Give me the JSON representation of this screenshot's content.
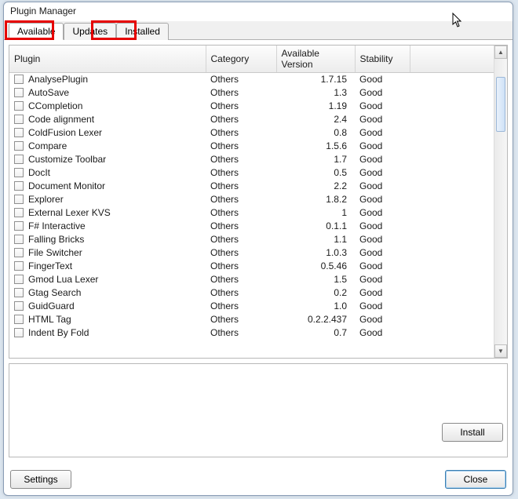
{
  "window": {
    "title": "Plugin Manager"
  },
  "tabs": {
    "available": "Available",
    "updates": "Updates",
    "installed": "Installed"
  },
  "columns": {
    "plugin": "Plugin",
    "category": "Category",
    "version": "Available Version",
    "stability": "Stability"
  },
  "rows": [
    {
      "name": "AnalysePlugin",
      "cat": "Others",
      "ver": "1.7.15",
      "stab": "Good"
    },
    {
      "name": "AutoSave",
      "cat": "Others",
      "ver": "1.3",
      "stab": "Good"
    },
    {
      "name": "CCompletion",
      "cat": "Others",
      "ver": "1.19",
      "stab": "Good"
    },
    {
      "name": "Code alignment",
      "cat": "Others",
      "ver": "2.4",
      "stab": "Good"
    },
    {
      "name": "ColdFusion Lexer",
      "cat": "Others",
      "ver": "0.8",
      "stab": "Good"
    },
    {
      "name": "Compare",
      "cat": "Others",
      "ver": "1.5.6",
      "stab": "Good"
    },
    {
      "name": "Customize Toolbar",
      "cat": "Others",
      "ver": "1.7",
      "stab": "Good"
    },
    {
      "name": "DocIt",
      "cat": "Others",
      "ver": "0.5",
      "stab": "Good"
    },
    {
      "name": "Document Monitor",
      "cat": "Others",
      "ver": "2.2",
      "stab": "Good"
    },
    {
      "name": "Explorer",
      "cat": "Others",
      "ver": "1.8.2",
      "stab": "Good"
    },
    {
      "name": "External Lexer KVS",
      "cat": "Others",
      "ver": "1",
      "stab": "Good"
    },
    {
      "name": "F# Interactive",
      "cat": "Others",
      "ver": "0.1.1",
      "stab": "Good"
    },
    {
      "name": "Falling Bricks",
      "cat": "Others",
      "ver": "1.1",
      "stab": "Good"
    },
    {
      "name": "File Switcher",
      "cat": "Others",
      "ver": "1.0.3",
      "stab": "Good"
    },
    {
      "name": "FingerText",
      "cat": "Others",
      "ver": "0.5.46",
      "stab": "Good"
    },
    {
      "name": "Gmod Lua Lexer",
      "cat": "Others",
      "ver": "1.5",
      "stab": "Good"
    },
    {
      "name": "Gtag Search",
      "cat": "Others",
      "ver": "0.2",
      "stab": "Good"
    },
    {
      "name": "GuidGuard",
      "cat": "Others",
      "ver": "1.0",
      "stab": "Good"
    },
    {
      "name": "HTML Tag",
      "cat": "Others",
      "ver": "0.2.2.437",
      "stab": "Good"
    },
    {
      "name": "Indent By Fold",
      "cat": "Others",
      "ver": "0.7",
      "stab": "Good"
    }
  ],
  "buttons": {
    "install": "Install",
    "settings": "Settings",
    "close": "Close"
  }
}
